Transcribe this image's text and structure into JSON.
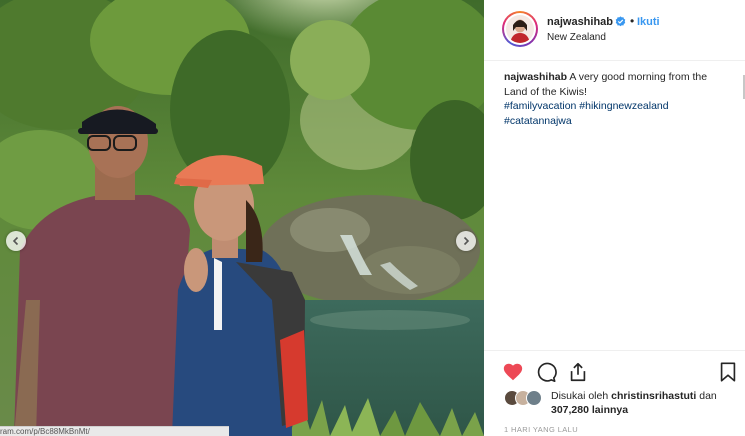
{
  "post": {
    "username": "najwashihab",
    "follow_label": "Ikuti",
    "separator": "•",
    "location": "New Zealand",
    "caption": {
      "text": "A very good morning from the Land of the Kiwis!",
      "hashtags": [
        "#familyvacation",
        "#hikingnewzealand",
        "#catatannajwa"
      ]
    },
    "likes": {
      "prefix": "Disukai oleh",
      "user": "christinsrihastuti",
      "joiner": "dan",
      "count": "307,280",
      "suffix": "lainnya"
    },
    "timestamp": "1 HARI YANG LALU",
    "url_fragment": "ram.com/p/Bc88MkBnMt/"
  },
  "icons": {
    "verified": "verified-badge-icon",
    "like": "heart-icon",
    "comment": "comment-icon",
    "share": "share-icon",
    "save": "bookmark-icon",
    "prev": "chevron-left-icon",
    "next": "chevron-right-icon"
  },
  "colors": {
    "like_red": "#ed4956",
    "link_blue": "#3897f0",
    "hashtag_blue": "#003569",
    "verified_blue": "#3897f0"
  }
}
